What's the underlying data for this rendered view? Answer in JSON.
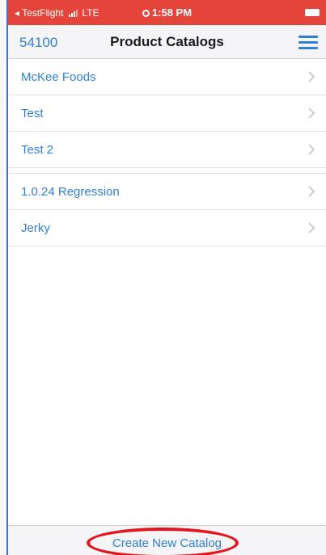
{
  "status_bar": {
    "back_app": "◂ TestFlight",
    "network": "LTE",
    "time": "1:58 PM"
  },
  "nav": {
    "left_label": "54100",
    "title": "Product Catalogs",
    "menu_icon": "hamburger-menu-icon"
  },
  "catalogs": [
    {
      "label": "McKee Foods"
    },
    {
      "label": "Test"
    },
    {
      "label": "Test 2"
    },
    {
      "label": "1.0.24 Regression"
    },
    {
      "label": "Jerky"
    }
  ],
  "footer": {
    "create_label": "Create New Catalog"
  },
  "colors": {
    "status_bar": "#e4443a",
    "accent": "#2f7fd6",
    "annotation": "#e3141b"
  }
}
